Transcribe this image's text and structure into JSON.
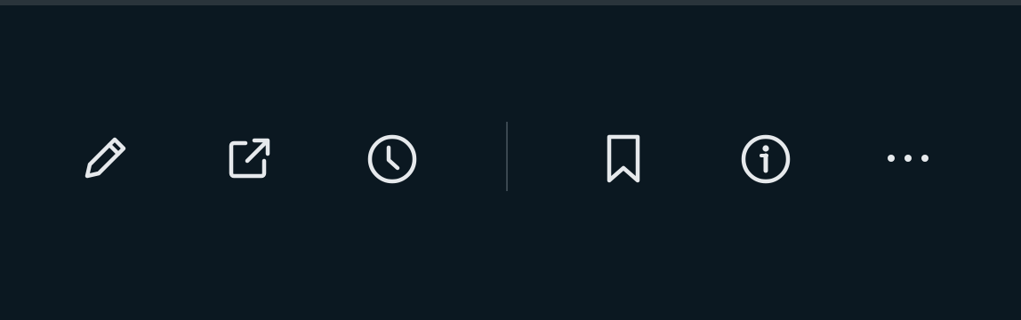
{
  "colors": {
    "background": "#0b1821",
    "icon": "#e6e9ec",
    "divider": "#3a4750",
    "top_border": "#2a343b"
  },
  "toolbar": {
    "items": [
      {
        "icon": "pencil-icon",
        "action": "edit"
      },
      {
        "icon": "external-link-icon",
        "action": "open-external"
      },
      {
        "icon": "clock-icon",
        "action": "history"
      },
      {
        "icon": "bookmark-icon",
        "action": "bookmark"
      },
      {
        "icon": "info-icon",
        "action": "info"
      },
      {
        "icon": "more-horizontal-icon",
        "action": "more"
      }
    ]
  }
}
